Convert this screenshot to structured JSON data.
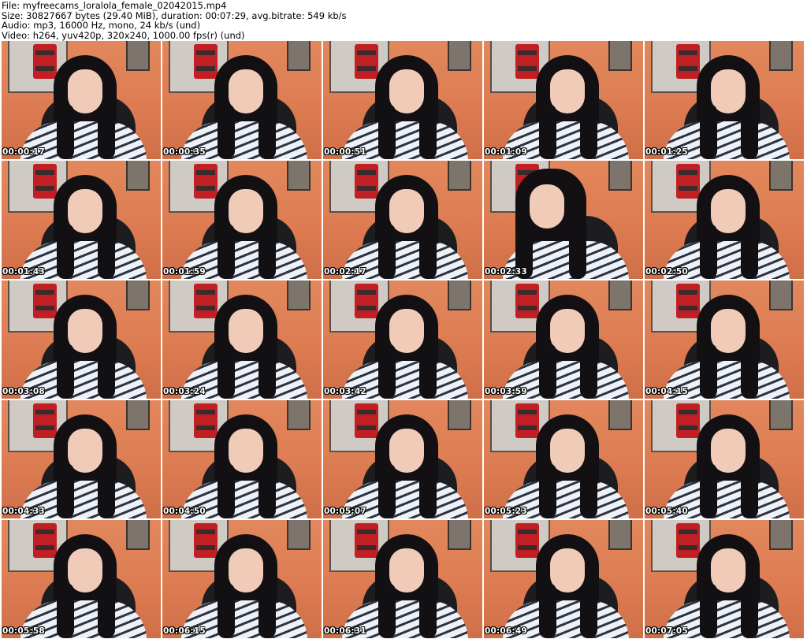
{
  "header": {
    "file": "File: myfreecams_loralola_female_02042015.mp4",
    "size": "Size: 30827667 bytes (29.40 MiB), duration: 00:07:29, avg.bitrate: 549 kb/s",
    "audio": "Audio: mp3, 16000 Hz, mono, 24 kb/s (und)",
    "video": "Video: h264, yuv420p, 320x240, 1000.00 fps(r) (und)"
  },
  "thumbnails": [
    {
      "timestamp": "00:00:17"
    },
    {
      "timestamp": "00:00:35"
    },
    {
      "timestamp": "00:00:51"
    },
    {
      "timestamp": "00:01:09"
    },
    {
      "timestamp": "00:01:25"
    },
    {
      "timestamp": "00:01:43"
    },
    {
      "timestamp": "00:01:59"
    },
    {
      "timestamp": "00:02:17"
    },
    {
      "timestamp": "00:02:33"
    },
    {
      "timestamp": "00:02:50"
    },
    {
      "timestamp": "00:03:08"
    },
    {
      "timestamp": "00:03:24"
    },
    {
      "timestamp": "00:03:42"
    },
    {
      "timestamp": "00:03:59"
    },
    {
      "timestamp": "00:04:15"
    },
    {
      "timestamp": "00:04:33"
    },
    {
      "timestamp": "00:04:50"
    },
    {
      "timestamp": "00:05:07"
    },
    {
      "timestamp": "00:05:23"
    },
    {
      "timestamp": "00:05:40"
    },
    {
      "timestamp": "00:05:58"
    },
    {
      "timestamp": "00:06:15"
    },
    {
      "timestamp": "00:06:31"
    },
    {
      "timestamp": "00:06:49"
    },
    {
      "timestamp": "00:07:05"
    }
  ]
}
